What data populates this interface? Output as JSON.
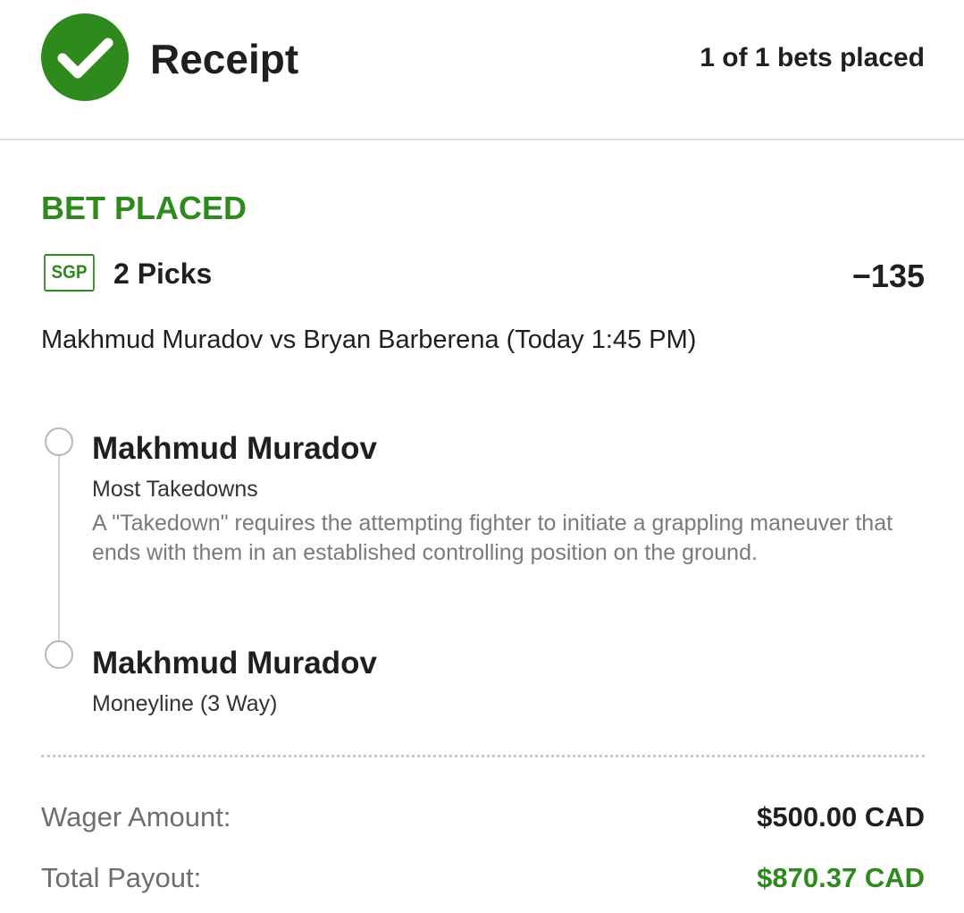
{
  "header": {
    "title": "Receipt",
    "bets_placed": "1 of 1 bets placed"
  },
  "bet": {
    "status": "BET PLACED",
    "badge": "SGP",
    "picks_count": "2 Picks",
    "odds": "−135",
    "event": "Makhmud Muradov vs Bryan Barberena (Today 1:45 PM)",
    "picks": [
      {
        "name": "Makhmud Muradov",
        "market": "Most Takedowns",
        "description": "A \"Takedown\" requires the attempting fighter to initiate a grappling maneuver that ends with them in an established controlling position on the ground."
      },
      {
        "name": "Makhmud Muradov",
        "market": "Moneyline (3 Way)"
      }
    ]
  },
  "totals": {
    "wager_label": "Wager Amount:",
    "wager_value": "$500.00 CAD",
    "payout_label": "Total Payout:",
    "payout_value": "$870.37 CAD"
  },
  "colors": {
    "accent_green": "#2e8a1c",
    "text_dark": "#1f1f1f",
    "text_muted": "#7a7a7a"
  },
  "icons": {
    "status_icon": "check-circle-icon",
    "pick_marker": "timeline-circle-icon"
  }
}
